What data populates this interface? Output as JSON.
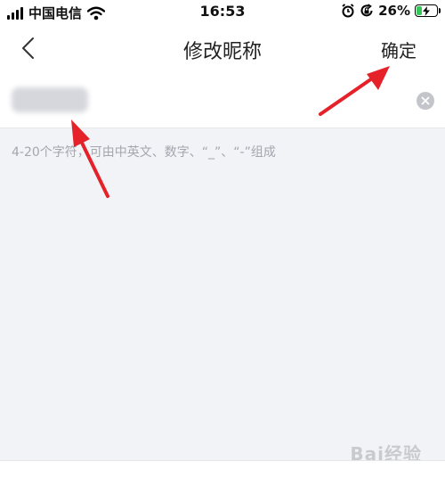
{
  "status_bar": {
    "carrier": "中国电信",
    "time": "16:53",
    "battery_percent_label": "26%",
    "battery_level": 0.26,
    "icons": [
      "signal-icon",
      "wifi-icon",
      "alarm-icon",
      "orientation-lock-icon",
      "battery-icon"
    ]
  },
  "nav": {
    "title": "修改昵称",
    "confirm_label": "确定",
    "back_icon": "chevron-left-icon"
  },
  "nickname_field": {
    "value": "",
    "clear_icon": "clear-icon"
  },
  "hint_text": "4-20个字符，可由中英文、数字、“_”、“-”组成",
  "watermark": "Bai经验",
  "colors": {
    "background": "#f2f3f7",
    "surface": "#ffffff",
    "hint": "#a4a6ad",
    "annotation_arrow": "#e5222a",
    "battery_charge": "#35c759"
  }
}
